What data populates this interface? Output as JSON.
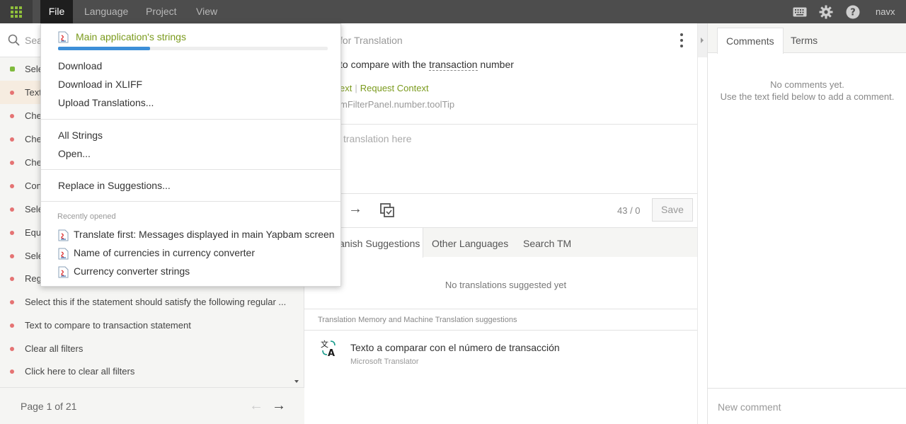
{
  "topbar": {
    "menus": [
      "File",
      "Language",
      "Project",
      "View"
    ],
    "user": "navx",
    "icons": [
      "apps-grid-icon",
      "keyboard-icon",
      "gear-icon",
      "help-icon"
    ]
  },
  "left": {
    "search_placeholder": "Sea",
    "rows": [
      {
        "label": "Sele",
        "status": "green"
      },
      {
        "label": "Text",
        "status": "red"
      },
      {
        "label": "Che",
        "status": "red"
      },
      {
        "label": "Che",
        "status": "red"
      },
      {
        "label": "Che",
        "status": "red"
      },
      {
        "label": "Con",
        "status": "red"
      },
      {
        "label": "Sele",
        "status": "red"
      },
      {
        "label": "Equ",
        "status": "red"
      },
      {
        "label": "Sele",
        "status": "red"
      },
      {
        "label": "Reg",
        "status": "red"
      },
      {
        "label": "Select this if the statement should satisfy the following regular ...",
        "status": "red"
      },
      {
        "label": "Text to compare to transaction statement",
        "status": "red"
      },
      {
        "label": "Clear all filters",
        "status": "red"
      },
      {
        "label": "Click here to clear all filters",
        "status": "red"
      }
    ],
    "pager": "Page 1 of 21"
  },
  "center": {
    "header_title": "for Translation",
    "source_before": "to compare with the ",
    "source_term": "transaction",
    "source_after": " number",
    "context_link1": "ext",
    "context_sep": "|",
    "context_link2": "Request Context",
    "string_key": "mFilterPanel.number.toolTip",
    "translation_placeholder": "translation here",
    "char_count": "43 / 0",
    "save_label": "Save",
    "tabs": [
      "anish Suggestions",
      "Other Languages",
      "Search TM"
    ],
    "no_suggestions": "No translations suggested yet",
    "tm_header": "Translation Memory and Machine Translation suggestions",
    "tm_text": "Texto a comparar con el número de transacción",
    "tm_source": "Microsoft Translator"
  },
  "right": {
    "tabs": [
      "Comments",
      "Terms"
    ],
    "no_comments_line1": "No comments yet.",
    "no_comments_line2": "Use the text field below to add a comment.",
    "new_comment_placeholder": "New comment"
  },
  "dropdown": {
    "project_name": "Main application's strings",
    "progress": 0.34,
    "items_group1": [
      "Download",
      "Download in XLIFF",
      "Upload Translations..."
    ],
    "items_group2": [
      "All Strings",
      "Open..."
    ],
    "items_group3": [
      "Replace in Suggestions..."
    ],
    "recent_label": "Recently opened",
    "recent": [
      "Translate first: Messages displayed in main Yapbam screen",
      "Name of currencies in currency converter",
      "Currency converter strings"
    ]
  }
}
